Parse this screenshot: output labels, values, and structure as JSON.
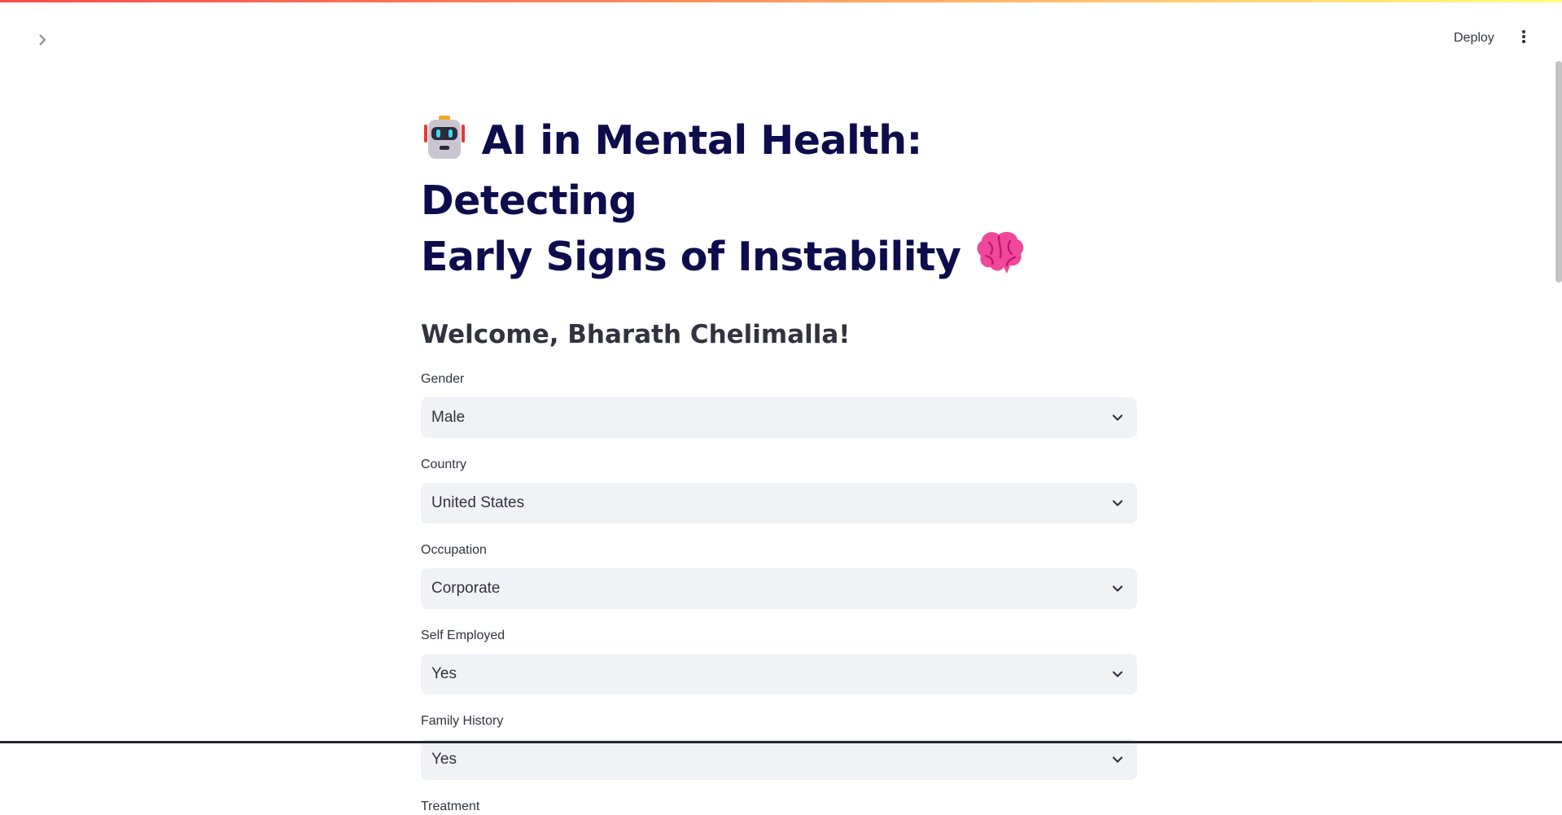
{
  "header": {
    "deploy_label": "Deploy",
    "sidebar_toggle_icon": "chevron-right-icon",
    "menu_icon": "kebab-menu-icon"
  },
  "main": {
    "title_line1": "AI in Mental Health: Detecting",
    "title_line2": "Early Signs of Instability",
    "title_icons": [
      "robot-emoji-icon",
      "brain-emoji-icon"
    ],
    "welcome": "Welcome, Bharath Chelimalla!",
    "fields": [
      {
        "label": "Gender",
        "value": "Male"
      },
      {
        "label": "Country",
        "value": "United States"
      },
      {
        "label": "Occupation",
        "value": "Corporate"
      },
      {
        "label": "Self Employed",
        "value": "Yes"
      },
      {
        "label": "Family History",
        "value": "Yes"
      },
      {
        "label": "Treatment"
      }
    ]
  },
  "colors": {
    "title": "#0d0d4d",
    "text": "#31333f",
    "select_bg": "#f0f2f6",
    "accent_gradient_start": "#ff4b4b",
    "accent_gradient_end": "#fffd80"
  }
}
